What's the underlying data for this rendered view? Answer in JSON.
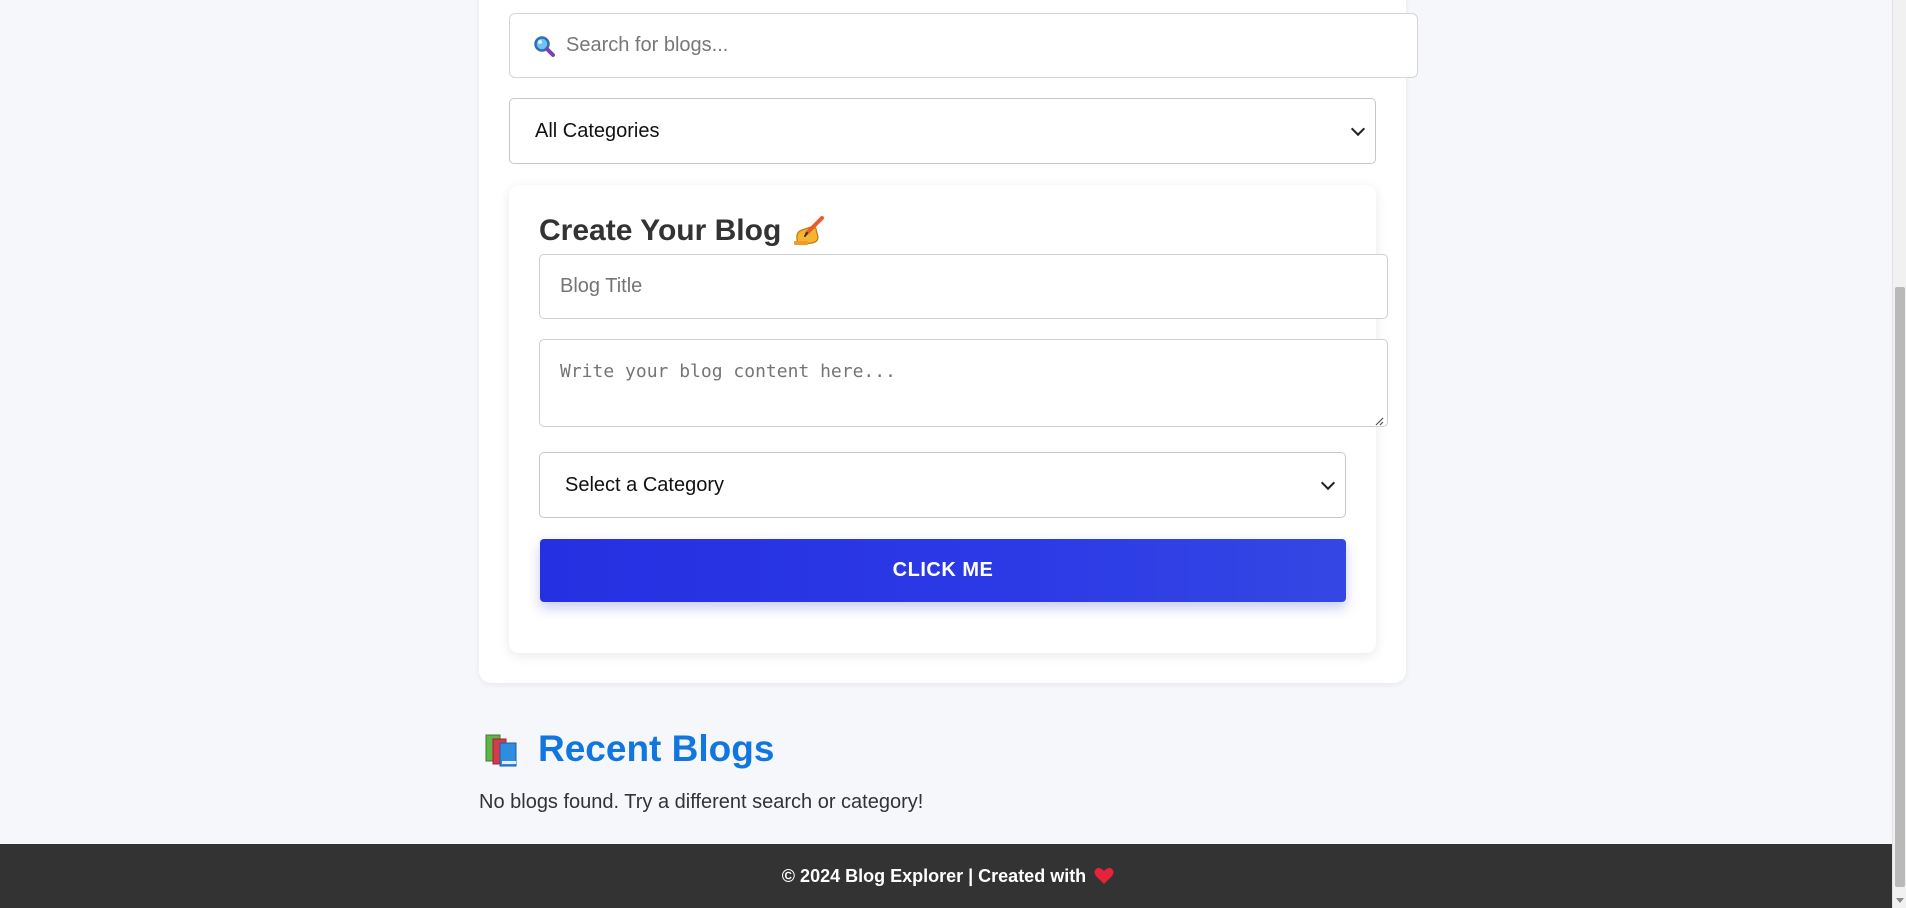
{
  "search": {
    "placeholder": "Search for blogs...",
    "icon": "magnifier-icon"
  },
  "category_filter": {
    "selected": "All Categories"
  },
  "create_form": {
    "title": "Create Your Blog",
    "title_icon": "writing-hand-icon",
    "title_placeholder": "Blog Title",
    "content_placeholder": "Write your blog content here...",
    "category_selected": "Select a Category",
    "submit_label": "CLICK ME",
    "button_color": "#2530e2"
  },
  "recent": {
    "heading": "Recent Blogs",
    "heading_icon": "books-icon",
    "heading_color": "#1176e0",
    "empty_message": "No blogs found. Try a different search or category!"
  },
  "footer": {
    "text": "© 2024 Blog Explorer | Created with",
    "icon": "heart-icon",
    "background": "#333333"
  }
}
